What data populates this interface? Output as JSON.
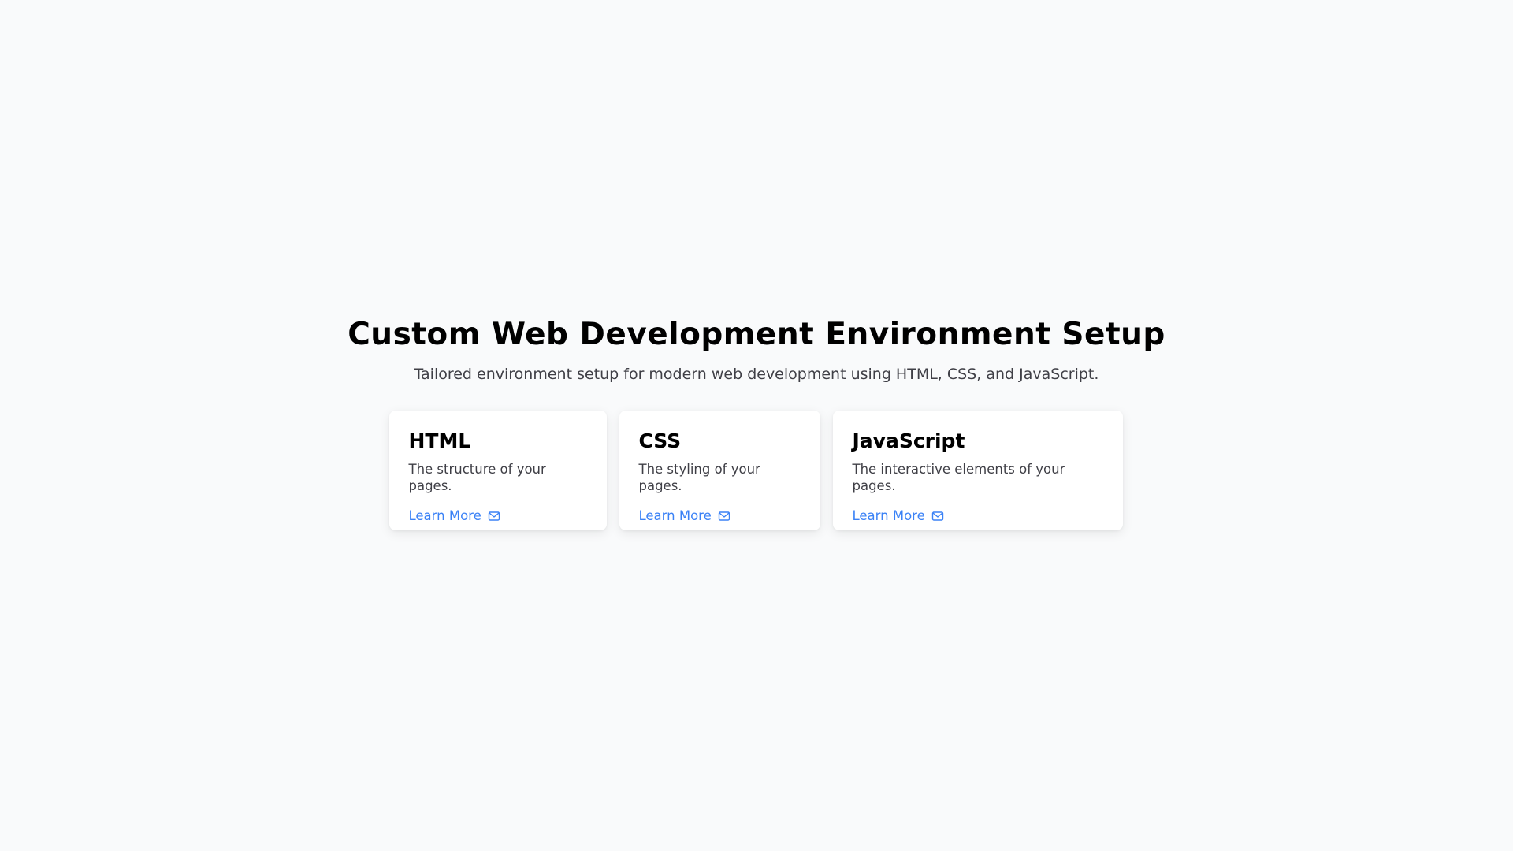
{
  "header": {
    "title": "Custom Web Development Environment Setup",
    "subtitle": "Tailored environment setup for modern web development using HTML, CSS, and JavaScript."
  },
  "cards": [
    {
      "title": "HTML",
      "description": "The structure of your pages.",
      "link_label": "Learn More",
      "icon": "mail-icon"
    },
    {
      "title": "CSS",
      "description": "The styling of your pages.",
      "link_label": "Learn More",
      "icon": "mail-icon"
    },
    {
      "title": "JavaScript",
      "description": "The interactive elements of your pages.",
      "link_label": "Learn More",
      "icon": "mail-icon"
    }
  ],
  "colors": {
    "background": "#f9fafb",
    "card": "#ffffff",
    "link": "#3b82f6",
    "muted_text": "#3f3f46"
  }
}
